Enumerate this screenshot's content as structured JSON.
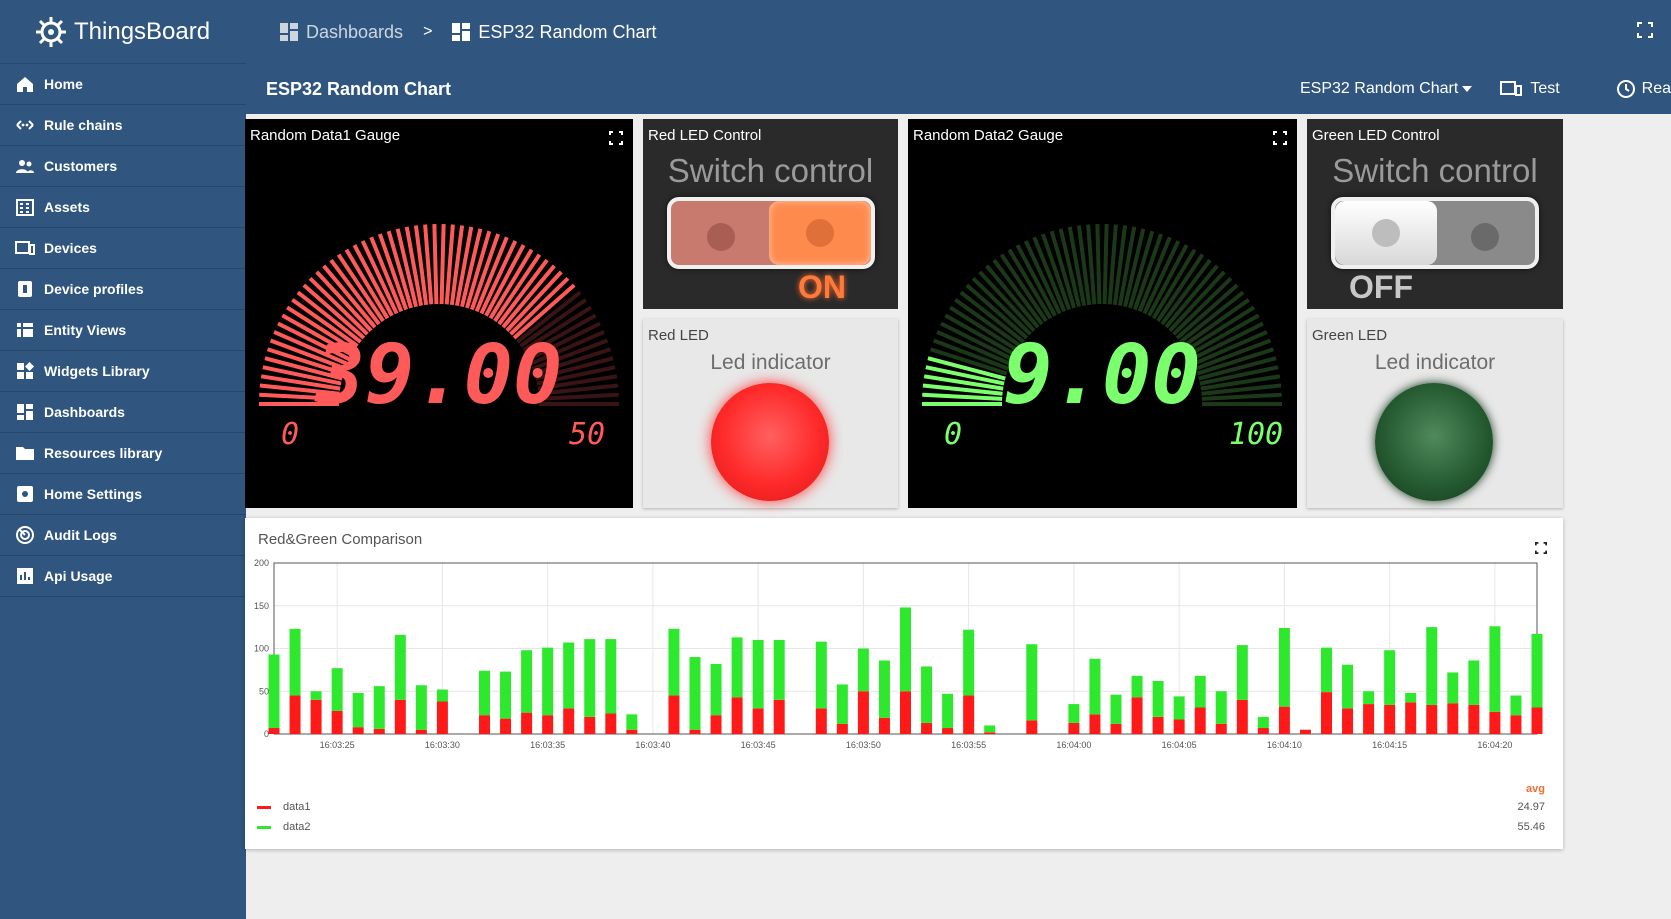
{
  "app": {
    "logo_text": "ThingsBoard"
  },
  "sidebar": {
    "items": [
      {
        "label": "Home",
        "icon": "home-icon"
      },
      {
        "label": "Rule chains",
        "icon": "rule-chains-icon"
      },
      {
        "label": "Customers",
        "icon": "customers-icon"
      },
      {
        "label": "Assets",
        "icon": "assets-icon"
      },
      {
        "label": "Devices",
        "icon": "devices-icon"
      },
      {
        "label": "Device profiles",
        "icon": "device-profiles-icon"
      },
      {
        "label": "Entity Views",
        "icon": "entity-views-icon"
      },
      {
        "label": "Widgets Library",
        "icon": "widgets-icon"
      },
      {
        "label": "Dashboards",
        "icon": "dashboards-icon"
      },
      {
        "label": "Resources library",
        "icon": "folder-icon"
      },
      {
        "label": "Home Settings",
        "icon": "settings-icon"
      },
      {
        "label": "Audit Logs",
        "icon": "audit-icon"
      },
      {
        "label": "Api Usage",
        "icon": "api-usage-icon"
      }
    ]
  },
  "breadcrumb": {
    "parent": "Dashboards",
    "separator": ">",
    "current": "ESP32 Random Chart"
  },
  "dashboard": {
    "title": "ESP32 Random Chart",
    "state_selector": "ESP32 Random Chart",
    "entity_alias": "Test",
    "timewindow": "Realti"
  },
  "widgets": {
    "gauge1": {
      "title": "Random Data1 Gauge",
      "value": "39.00",
      "min": "0",
      "max": "50",
      "level": 0.78,
      "color": "#ff5a5a"
    },
    "red_switch": {
      "title": "Red LED Control",
      "label": "Switch control",
      "state": "ON",
      "color": "#ff8a4e"
    },
    "gauge2": {
      "title": "Random Data2 Gauge",
      "value": "9.00",
      "min": "0",
      "max": "100",
      "level": 0.09,
      "color": "#7cff6c"
    },
    "green_switch": {
      "title": "Green LED Control",
      "label": "Switch control",
      "state": "OFF"
    },
    "red_led": {
      "title": "Red LED",
      "label": "Led indicator",
      "color": "#ff3b3b",
      "on": true
    },
    "green_led": {
      "title": "Green LED",
      "label": "Led indicator",
      "color": "#1e5c2a",
      "on": false
    }
  },
  "chart": {
    "title": "Red&Green Comparison",
    "legend_header": "avg",
    "legend": [
      {
        "name": "data1",
        "color": "#ff1a1a",
        "avg": "24.97"
      },
      {
        "name": "data2",
        "color": "#2ee82e",
        "avg": "55.46"
      }
    ]
  },
  "chart_data": {
    "type": "bar",
    "title": "Red&Green Comparison",
    "ylim": [
      0,
      200
    ],
    "yticks": [
      0,
      50,
      100,
      150,
      200
    ],
    "xticks": [
      "16:03:25",
      "16:03:30",
      "16:03:35",
      "16:03:40",
      "16:03:45",
      "16:03:50",
      "16:03:55",
      "16:04:00",
      "16:04:05",
      "16:04:10",
      "16:04:15",
      "16:04:20"
    ],
    "x_start": "16:03:22",
    "x_end": "16:04:22",
    "grid": true,
    "stacked": true,
    "legend_position": "bottom-left",
    "series": [
      {
        "name": "data1",
        "x": [
          "16:03:22",
          "16:03:23",
          "16:03:24",
          "16:03:25",
          "16:03:26",
          "16:03:27",
          "16:03:28",
          "16:03:29",
          "16:03:30",
          "16:03:32",
          "16:03:33",
          "16:03:34",
          "16:03:35",
          "16:03:36",
          "16:03:37",
          "16:03:38",
          "16:03:39",
          "16:03:41",
          "16:03:42",
          "16:03:43",
          "16:03:44",
          "16:03:45",
          "16:03:46",
          "16:03:48",
          "16:03:49",
          "16:03:50",
          "16:03:51",
          "16:03:52",
          "16:03:53",
          "16:03:54",
          "16:03:55",
          "16:03:56",
          "16:03:58",
          "16:04:00",
          "16:04:01",
          "16:04:02",
          "16:04:03",
          "16:04:04",
          "16:04:05",
          "16:04:06",
          "16:04:07",
          "16:04:08",
          "16:04:09",
          "16:04:10",
          "16:04:11",
          "16:04:12",
          "16:04:13",
          "16:04:14",
          "16:04:15",
          "16:04:16",
          "16:04:17",
          "16:04:18",
          "16:04:19",
          "16:04:20",
          "16:04:21",
          "16:04:22"
        ],
        "values": [
          7,
          45,
          40,
          27,
          8,
          6,
          40,
          5,
          38,
          22,
          18,
          25,
          22,
          30,
          20,
          24,
          5,
          45,
          5,
          22,
          43,
          30,
          40,
          30,
          12,
          50,
          19,
          50,
          13,
          7,
          45,
          2,
          16,
          13,
          23,
          12,
          43,
          20,
          17,
          31,
          12,
          40,
          7,
          32,
          5,
          49,
          30,
          35,
          34,
          37,
          34,
          36,
          34,
          26,
          22,
          31
        ]
      },
      {
        "name": "data2",
        "x": [
          "16:03:22",
          "16:03:23",
          "16:03:24",
          "16:03:25",
          "16:03:26",
          "16:03:27",
          "16:03:28",
          "16:03:29",
          "16:03:30",
          "16:03:32",
          "16:03:33",
          "16:03:34",
          "16:03:35",
          "16:03:36",
          "16:03:37",
          "16:03:38",
          "16:03:39",
          "16:03:41",
          "16:03:42",
          "16:03:43",
          "16:03:44",
          "16:03:45",
          "16:03:46",
          "16:03:48",
          "16:03:49",
          "16:03:50",
          "16:03:51",
          "16:03:52",
          "16:03:53",
          "16:03:54",
          "16:03:55",
          "16:03:56",
          "16:03:58",
          "16:04:00",
          "16:04:01",
          "16:04:02",
          "16:04:03",
          "16:04:04",
          "16:04:05",
          "16:04:06",
          "16:04:07",
          "16:04:08",
          "16:04:09",
          "16:04:10",
          "16:04:11",
          "16:04:12",
          "16:04:13",
          "16:04:14",
          "16:04:15",
          "16:04:16",
          "16:04:17",
          "16:04:18",
          "16:04:19",
          "16:04:20",
          "16:04:21",
          "16:04:22"
        ],
        "values": [
          86,
          78,
          10,
          50,
          40,
          50,
          76,
          52,
          14,
          52,
          55,
          73,
          79,
          77,
          91,
          87,
          18,
          78,
          85,
          60,
          70,
          80,
          70,
          78,
          46,
          50,
          67,
          98,
          66,
          40,
          77,
          8,
          89,
          22,
          65,
          34,
          25,
          42,
          27,
          37,
          38,
          64,
          13,
          92,
          0,
          52,
          51,
          15,
          64,
          11,
          91,
          36,
          52,
          100,
          23,
          86
        ]
      }
    ]
  }
}
